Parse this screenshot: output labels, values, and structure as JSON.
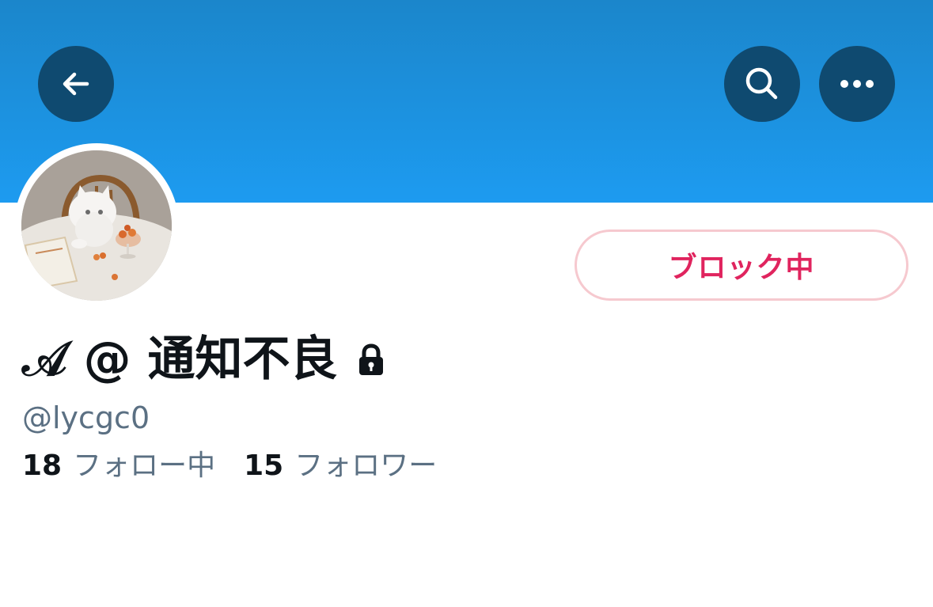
{
  "header": {
    "banner_color": "#1d9bf0",
    "back_icon": "arrow-left-icon",
    "search_icon": "search-icon",
    "more_icon": "more-horizontal-icon"
  },
  "profile": {
    "display_name": "𝒜 @ 通知不良",
    "protected_icon": "lock-icon",
    "handle": "@lycgc0",
    "avatar_icon": "avatar-photo"
  },
  "actions": {
    "blocked_label": "ブロック中",
    "blocked_color": "#e0245e"
  },
  "stats": {
    "following_count": "18",
    "following_label": "フォロー中",
    "followers_count": "15",
    "followers_label": "フォロワー"
  }
}
